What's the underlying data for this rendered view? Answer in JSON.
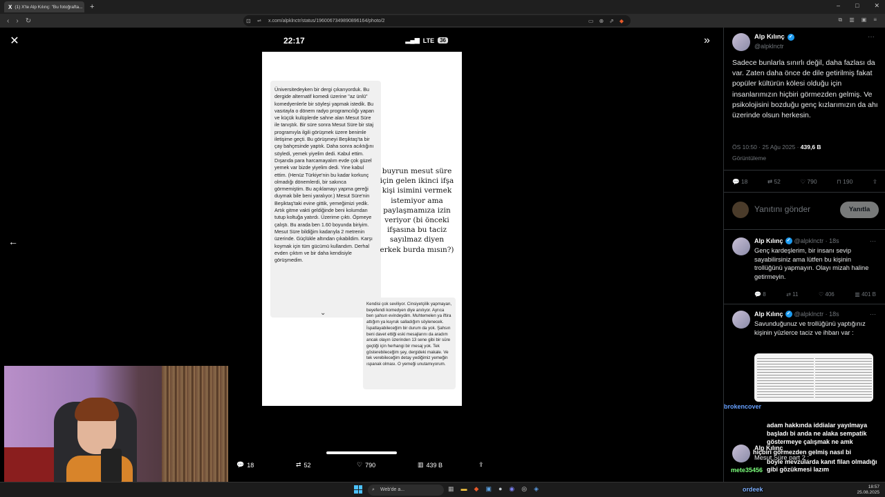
{
  "browser": {
    "tab_title": "(1) X'te Alp Kılınç: \"Bu fotoğrafta...",
    "tab_logo": "X",
    "tab_close": "×",
    "new_tab": "+",
    "url": "x.com/alpklnctr/status/1960067349890896164/photo/2",
    "minimize": "–",
    "maximize": "□",
    "close": "✕"
  },
  "phone": {
    "time": "22:17",
    "network": "LTE",
    "battery": "36"
  },
  "note1": {
    "text": "Üniversitedeyken bir dergi çıkarıyorduk. Bu dergide alternatif komedi üzerine \"az ünlü\" komedyenlerle bir söyleşi yapmak istedik. Bu vasıtayla o dönem radyo programcılığı yapan ve küçük kulüplerde sahne alan Mesut Süre ile tanıştık. Bir süre sonra Mesut Süre bir staj programıyla ilgili görüşmek üzere benimle iletişime geçti. Bu görüşmeyi Beşiktaş'ta bir çay bahçesinde yaptık. Daha sonra acıktığını söyledi, yemek yiyelim dedi. Kabul ettim. Dışarıda para harcamayalım evde çok güzel yemek var bizde yiyelim dedi. Yine kabul ettim. (Henüz Türkiye'nin bu kadar korkunç olmadığı dönemlerdi, bir sakınca görmemiştim. Bu açıklamayı yapma gereği duymak bile beni yaralıyor.) Mesut Süre'nin Beşiktaş'taki evine gittik, yemeğimizi yedik. Artık gitme vakti geldiğinde beni kolumdan tutup koltuğa yatırdı. Üzerime çıktı. Öpmeye çalıştı. Bu arada ben 1.60 boyunda biriyim. Mesut Süre bildiğim kadarıyla 2 metrenin üzerinde. Güçlükle altından çıkabildim. Karşı koymak için tüm gücümü kullandım. Derhal evden çıktım ve bir daha kendisiyle görüşmedim."
  },
  "note2": {
    "text": "Kendisi çok seviliyor. Cinsiyetçilik yapmayan, beyefendi komedyen diye anılıyor. Ayrıca ben şahsın evindeydim. Muhtemelen ya iftira attığım ya kuyruk salladığım söylenecek. İspatlayabileceğim bir durum da yok. Şahsın beni davet ettiği eski mesajlarını da aradım ancak olayın üzerinden 13 sene gibi bir süre geçtiği için herhangi bir mesaj yok. Tek gösterebileceğim şey, dergideki makale. Ve tek verebileceğim detay yediğimiz yemeğin ıspanak olması. O yemeği unutamıyorum."
  },
  "handwritten": "buyrun mesut süre için gelen ikinci ifşa kişi isimini vermek istemiyor ama paylaşmamıza izin veriyor (bi önceki ifşasına bu taciz sayılmaz diyen erkek burda mısın?)",
  "photo_actions": {
    "replies": "18",
    "reposts": "52",
    "likes": "790",
    "views": "439 B"
  },
  "post": {
    "author": "Alp Kılınç",
    "handle": "@alpklnctr",
    "text": "Sadece bunlarla sınırlı değil, daha fazlası da var. Zaten daha önce de dile getirilmiş fakat popüler kültürün kölesi olduğu için insanlarımızın hiçbiri görmezden gelmiş. Ve psikolojisini bozduğu genç kızlarımızın da ahı üzerinde olsun herkesin.",
    "timestamp": "ÖS 10:50 · 25 Ağu 2025 ·",
    "views_count": "439,6 B",
    "views_label": "Görüntüleme",
    "stats": {
      "replies": "18",
      "reposts": "52",
      "likes": "790",
      "bookmarks": "190"
    }
  },
  "reply_box": {
    "placeholder": "Yanıtını gönder",
    "button": "Yanıtla"
  },
  "replies": [
    {
      "author": "Alp Kılınç",
      "handle": "@alpklnctr · 18s",
      "text": "Genç kardeşlerim, bir insanı sevip sayabilirsiniz ama lütfen bu kişinin trollüğünü yapmayın. Olayı mizah haline getirmeyin.",
      "replies": "8",
      "reposts": "11",
      "likes": "406",
      "views": "401 B"
    },
    {
      "author": "Alp Kılınç",
      "handle": "@alpklnctr · 18s",
      "text": "Savunduğunuz ve trollüğünü yaptığınız kişinin yüzlerce taciz ve ihbarı var :"
    },
    {
      "author": "Alp Kılınç",
      "text": "Mesut Süre part 2 :"
    }
  ],
  "chat": [
    {
      "user": "brokencover",
      "msg": ""
    },
    {
      "user": "",
      "msg": "adam hakkında iddialar yayılmaya başladı bi anda ne alaka sempatik göstermeye çalışmak ne amk"
    },
    {
      "user": "",
      "msg": "hiçbiri görmezden gelmiş nasıl bi"
    },
    {
      "user": "mete35456",
      "msg": "böyle mevzularda kanıt filan olmadığı gibi gözükmesi lazım"
    },
    {
      "user": "ordeek",
      "msg": ""
    }
  ],
  "taskbar": {
    "search": "Web'de a...",
    "time": "18:57",
    "date": "25.08.2025"
  },
  "colors": {
    "accent": "#1d9bf0",
    "bg": "#000000",
    "muted": "#71767b"
  }
}
